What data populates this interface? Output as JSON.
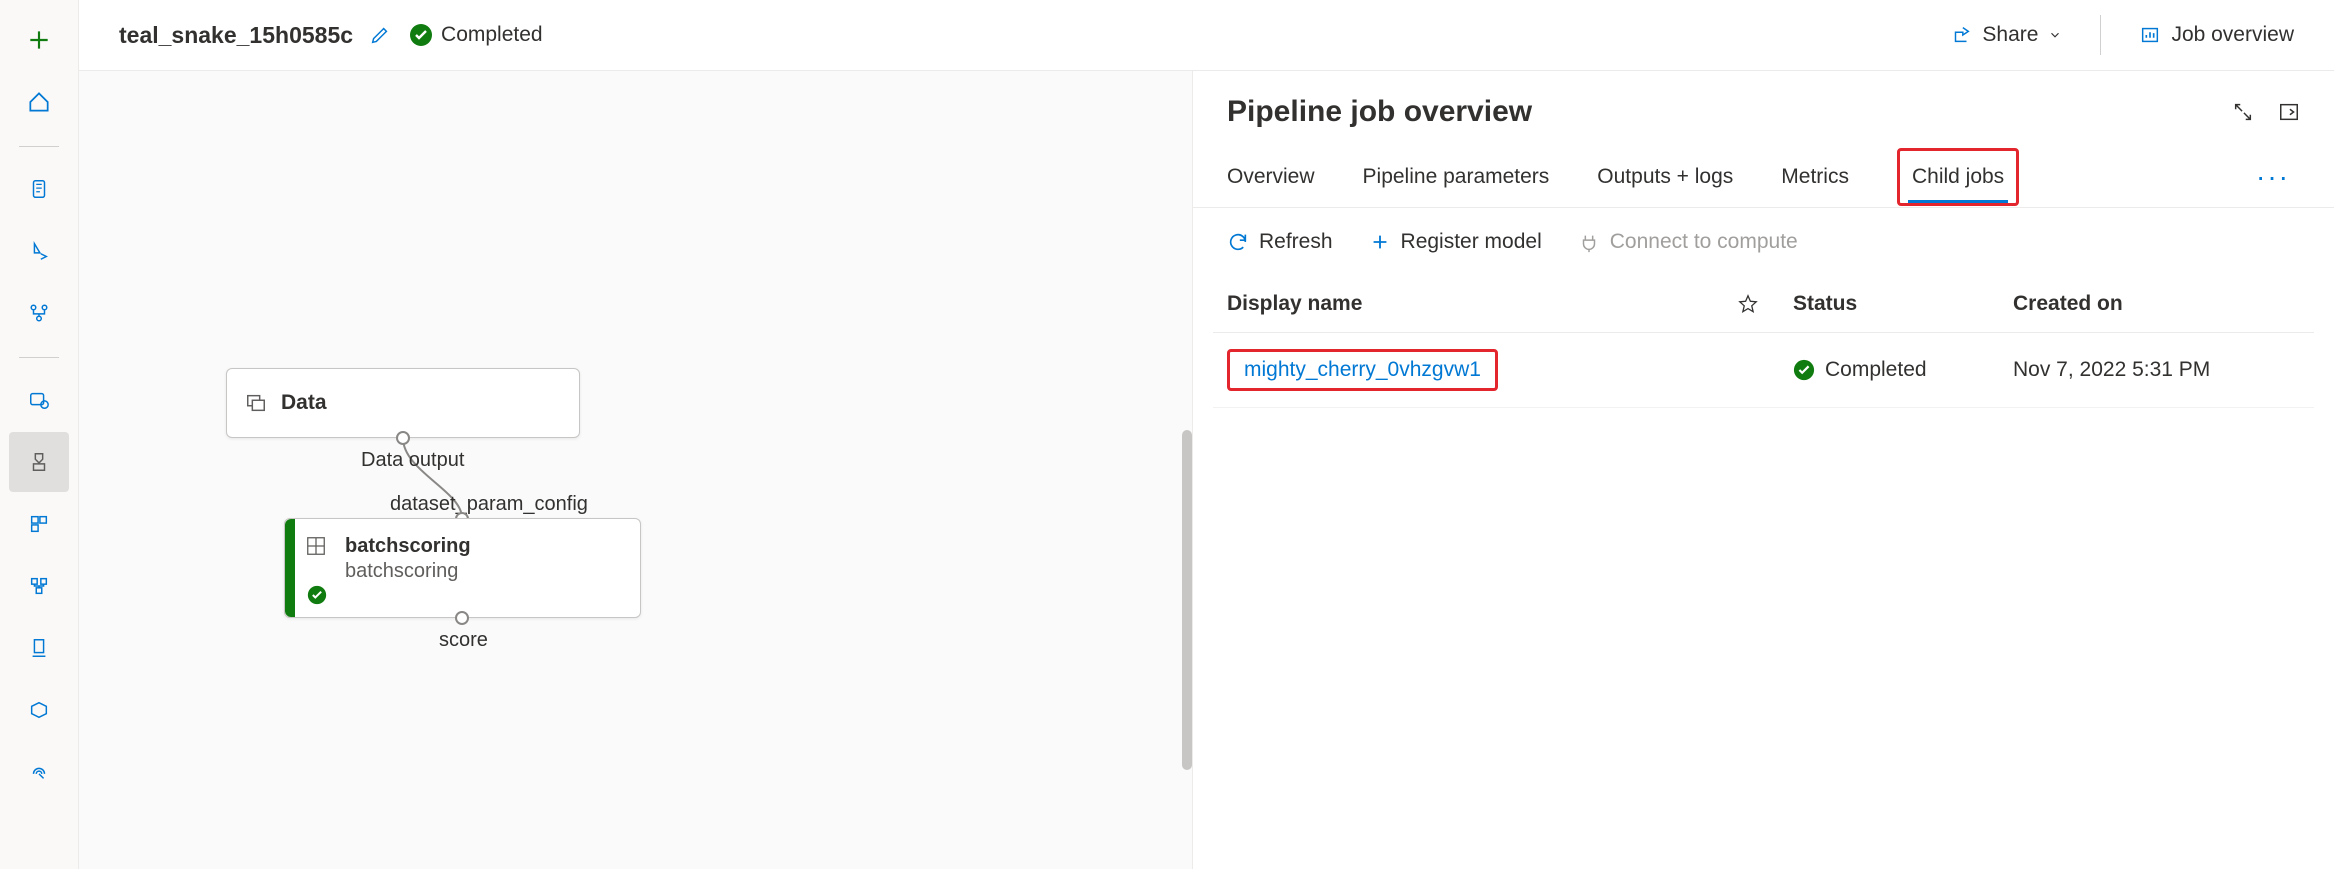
{
  "topbar": {
    "job_title": "teal_snake_15h0585c",
    "status_label": "Completed",
    "share_label": "Share",
    "overview_label": "Job overview"
  },
  "canvas": {
    "data_node_label": "Data",
    "data_output_label": "Data output",
    "edge_label": "dataset_param_config",
    "batch_title": "batchscoring",
    "batch_subtitle": "batchscoring",
    "score_label": "score"
  },
  "panel": {
    "title": "Pipeline job overview",
    "tabs": {
      "overview": "Overview",
      "params": "Pipeline parameters",
      "outputs": "Outputs + logs",
      "metrics": "Metrics",
      "child": "Child jobs"
    },
    "toolbar": {
      "refresh": "Refresh",
      "register": "Register model",
      "connect": "Connect to compute"
    },
    "columns": {
      "display_name": "Display name",
      "status": "Status",
      "created_on": "Created on"
    },
    "rows": [
      {
        "name": "mighty_cherry_0vhzgvw1",
        "status": "Completed",
        "created": "Nov 7, 2022 5:31 PM"
      }
    ]
  }
}
